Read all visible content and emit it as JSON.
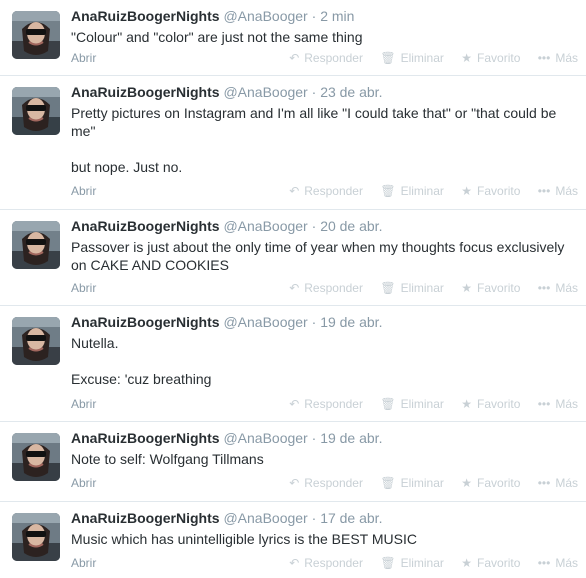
{
  "tweets": [
    {
      "fullname": "AnaRuizBoogerNights",
      "username": "@AnaBooger",
      "separator": "·",
      "time": "2 min",
      "lines": [
        "\"Colour\" and \"color\" are just not the same thing"
      ],
      "open": "Abrir",
      "reply": "Responder",
      "delete": "Eliminar",
      "favorite": "Favorito",
      "more": "Más"
    },
    {
      "fullname": "AnaRuizBoogerNights",
      "username": "@AnaBooger",
      "separator": "·",
      "time": "23 de abr.",
      "lines": [
        "Pretty pictures on Instagram and I'm all like \"I could take that\" or \"that could be me\"",
        "but nope. Just no."
      ],
      "open": "Abrir",
      "reply": "Responder",
      "delete": "Eliminar",
      "favorite": "Favorito",
      "more": "Más"
    },
    {
      "fullname": "AnaRuizBoogerNights",
      "username": "@AnaBooger",
      "separator": "·",
      "time": "20 de abr.",
      "lines": [
        "Passover is just about the only time of year when my thoughts focus exclusively on CAKE AND COOKIES"
      ],
      "open": "Abrir",
      "reply": "Responder",
      "delete": "Eliminar",
      "favorite": "Favorito",
      "more": "Más"
    },
    {
      "fullname": "AnaRuizBoogerNights",
      "username": "@AnaBooger",
      "separator": "·",
      "time": "19 de abr.",
      "lines": [
        "Nutella.",
        "Excuse: 'cuz breathing"
      ],
      "open": "Abrir",
      "reply": "Responder",
      "delete": "Eliminar",
      "favorite": "Favorito",
      "more": "Más"
    },
    {
      "fullname": "AnaRuizBoogerNights",
      "username": "@AnaBooger",
      "separator": "·",
      "time": "19 de abr.",
      "lines": [
        "Note to self: Wolfgang Tillmans"
      ],
      "open": "Abrir",
      "reply": "Responder",
      "delete": "Eliminar",
      "favorite": "Favorito",
      "more": "Más"
    },
    {
      "fullname": "AnaRuizBoogerNights",
      "username": "@AnaBooger",
      "separator": "·",
      "time": "17 de abr.",
      "lines": [
        "Music which has unintelligible lyrics is the BEST MUSIC"
      ],
      "open": "Abrir",
      "reply": "Responder",
      "delete": "Eliminar",
      "favorite": "Favorito",
      "more": "Más"
    }
  ],
  "icons": {
    "reply": "reply-icon",
    "delete": "trash-icon",
    "favorite": "star-icon",
    "more": "ellipsis-icon"
  },
  "colors": {
    "text": "#292f33",
    "muted": "#8899a6",
    "action": "#c8d0d5",
    "divider": "#e1e8ed"
  }
}
